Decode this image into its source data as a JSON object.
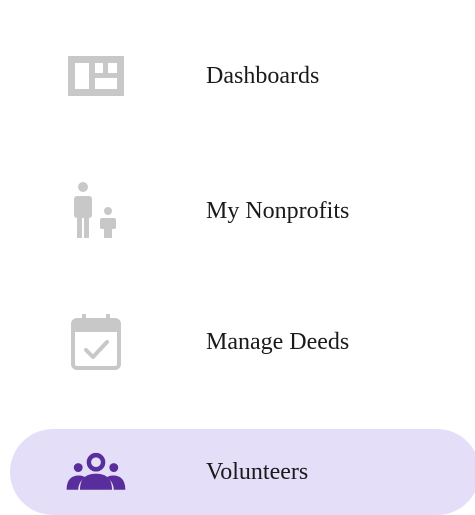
{
  "nav": {
    "items": [
      {
        "label": "Dashboards",
        "icon": "dashboard-grid-icon",
        "active": false
      },
      {
        "label": "My Nonprofits",
        "icon": "nonprofits-people-icon",
        "active": false
      },
      {
        "label": "Manage Deeds",
        "icon": "calendar-check-icon",
        "active": false
      },
      {
        "label": "Volunteers",
        "icon": "volunteers-group-icon",
        "active": true
      }
    ],
    "colors": {
      "icon_inactive": "#c8c8c8",
      "icon_active": "#5a2d9c",
      "active_background": "#e4def9",
      "label": "#1a1a1a"
    }
  }
}
